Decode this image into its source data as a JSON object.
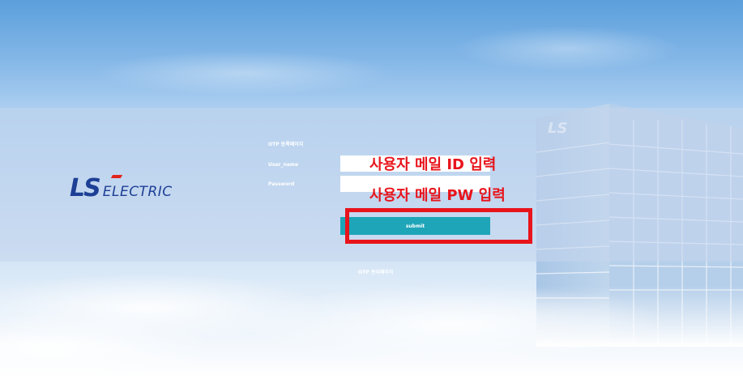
{
  "page": {
    "title_label": "OTP 등록페이지"
  },
  "logo": {
    "ls": "LS",
    "electric": "ELECTRIC"
  },
  "form": {
    "username_label": "User_name",
    "username_value": "",
    "password_label": "Password",
    "password_value": "",
    "submit_label": "submit"
  },
  "footer": {
    "admin_link": "OTP 관리페이지"
  },
  "annotations": {
    "id_hint": "사용자 메일 ID 입력",
    "pw_hint": "사용자 메일 PW 입력"
  },
  "colors": {
    "brand_blue": "#1d3f95",
    "brand_red": "#e3241b",
    "submit_teal": "#1ea5b8",
    "annotation_red": "#e8141b"
  }
}
